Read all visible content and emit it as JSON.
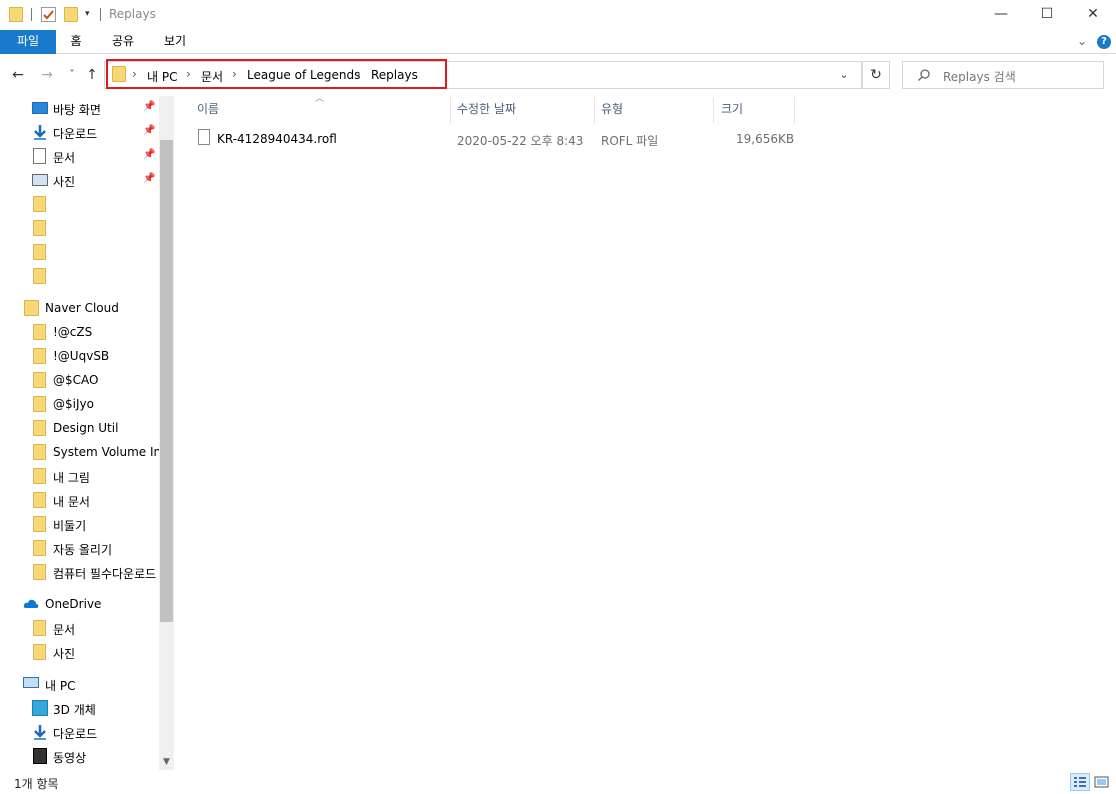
{
  "window": {
    "title": "Replays",
    "minimize_glyph": "—",
    "maximize_glyph": "☐",
    "close_glyph": "✕"
  },
  "ribbon": {
    "tabs": [
      "파일",
      "홈",
      "공유",
      "보기"
    ],
    "expand_glyph": "⌄",
    "help_glyph": "?"
  },
  "nav_buttons": {
    "back": "←",
    "forward": "→",
    "recent": "˅",
    "up": "↑"
  },
  "address": {
    "crumbs": [
      "내 PC",
      "문서",
      "League of Legends",
      "Replays"
    ],
    "separator": "›",
    "dropdown_glyph": "⌄",
    "refresh_glyph": "↻"
  },
  "search": {
    "placeholder": "Replays 검색"
  },
  "navpane": {
    "quick_access": [
      {
        "label": "바탕 화면",
        "icon": "desktop-icon",
        "pinned": true
      },
      {
        "label": "다운로드",
        "icon": "download-icon",
        "pinned": true
      },
      {
        "label": "문서",
        "icon": "document-icon",
        "pinned": true
      },
      {
        "label": "사진",
        "icon": "picture-icon",
        "pinned": true
      },
      {
        "label": "",
        "icon": "folder-icon",
        "pinned": false
      },
      {
        "label": "",
        "icon": "folder-icon",
        "pinned": false
      },
      {
        "label": "",
        "icon": "folder-icon",
        "pinned": false
      },
      {
        "label": "",
        "icon": "folder-icon",
        "pinned": false
      }
    ],
    "naver_cloud": {
      "label": "Naver Cloud",
      "items": [
        "!@cZS",
        "!@UqvSB",
        "@$CAO",
        "@$iJyo",
        "Design Util",
        "System Volume Info",
        "내 그림",
        "내 문서",
        "비둘기",
        "자동 올리기",
        "컴퓨터 필수다운로드"
      ]
    },
    "onedrive": {
      "label": "OneDrive",
      "items": [
        "문서",
        "사진"
      ]
    },
    "this_pc": {
      "label": "내 PC",
      "items": [
        {
          "label": "3D 개체",
          "icon": "3d-objects-icon"
        },
        {
          "label": "다운로드",
          "icon": "download-icon"
        },
        {
          "label": "동영상",
          "icon": "video-icon"
        }
      ]
    },
    "pin_glyph": "📌"
  },
  "columns": {
    "name": "이름",
    "date": "수정한 날짜",
    "type": "유형",
    "size": "크기"
  },
  "files": [
    {
      "name": "KR-4128940434.rofl",
      "date": "2020-05-22 오후 8:43",
      "type": "ROFL 파일",
      "size": "19,656KB"
    }
  ],
  "status": {
    "count": "1개 항목"
  },
  "colors": {
    "accent": "#1979ca",
    "highlight_border": "#e01b1b",
    "folder": "#f8d775"
  }
}
